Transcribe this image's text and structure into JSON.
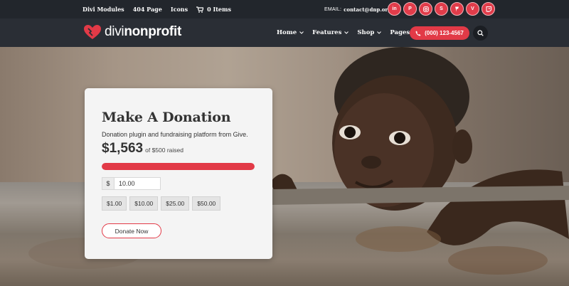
{
  "topbar": {
    "links": [
      "Divi Modules",
      "404 Page",
      "Icons"
    ],
    "cart_label": "0 Items",
    "email_label": "EMAIL:",
    "email_value": "contact@dnp.org",
    "social_icons": [
      "linkedin-icon",
      "pinterest-icon",
      "instagram-icon",
      "skype-icon",
      "foursquare-icon",
      "vimeo-icon",
      "twitch-icon"
    ]
  },
  "header": {
    "logo_light": "divi",
    "logo_bold": "nonprofit",
    "nav": [
      "Home",
      "Features",
      "Shop",
      "Pages"
    ],
    "phone": "(000) 123-4567"
  },
  "donation": {
    "title": "Make A Donation",
    "description": "Donation plugin and fundraising platform from Give.",
    "raised": "$1,563",
    "goal_text": "of $500 raised",
    "progress_fraction": 1.0,
    "currency_symbol": "$",
    "amount_value": "10.00",
    "levels": [
      "$1.00",
      "$10.00",
      "$25.00",
      "$50.00"
    ],
    "button_label": "Donate Now"
  },
  "colors": {
    "accent": "#e23a47",
    "topbar_bg": "#22262c",
    "header_bg": "#2a2e35",
    "card_bg": "#f4f4f4"
  }
}
